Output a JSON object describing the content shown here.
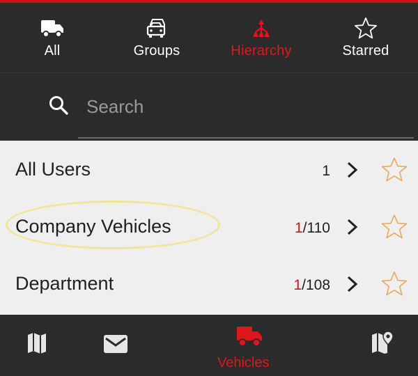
{
  "tabs": [
    {
      "label": "All",
      "icon": "truck-icon",
      "active": false
    },
    {
      "label": "Groups",
      "icon": "vehicles-group-icon",
      "active": false
    },
    {
      "label": "Hierarchy",
      "icon": "hierarchy-icon",
      "active": true
    },
    {
      "label": "Starred",
      "icon": "star-outline-icon",
      "active": false
    }
  ],
  "search": {
    "placeholder": "Search"
  },
  "list": [
    {
      "name": "All Users",
      "count_highlight": "",
      "count_rest": "1"
    },
    {
      "name": "Company Vehicles",
      "count_highlight": "1",
      "count_rest": "/110"
    },
    {
      "name": "Department",
      "count_highlight": "1",
      "count_rest": "/108"
    }
  ],
  "bottom_nav": {
    "items": [
      {
        "icon": "map-icon"
      },
      {
        "icon": "mail-icon"
      },
      {
        "icon": "vehicles-icon",
        "label": "Vehicles",
        "active": true
      },
      {
        "icon": "map-pin-icon"
      }
    ]
  },
  "colors": {
    "accent": "#d0111b",
    "background_dark": "#2b2b2b",
    "list_background": "#efefef",
    "star_outline": "#e7a95c"
  }
}
